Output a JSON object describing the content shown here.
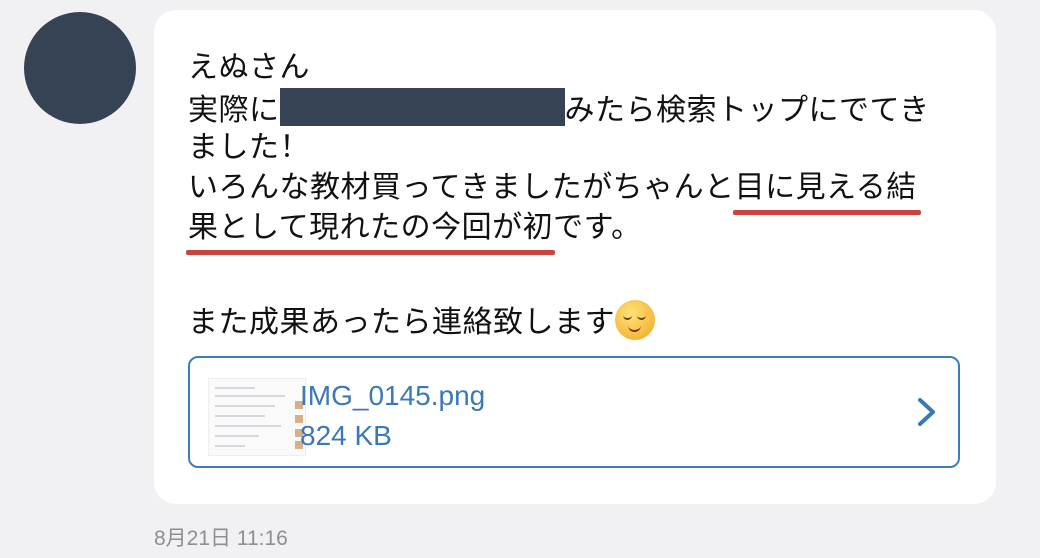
{
  "message": {
    "line1": "えぬさん",
    "line2_before": "実際に",
    "line2_after": "みたら検索トップにでてき",
    "line3": "ました！",
    "line4_before": "いろんな教材買ってきましたがちゃんと",
    "line4_highlight": "目に見える結",
    "line5_highlight": "果として現れたの今回が初",
    "line5_after": "です。",
    "line6": "また成果あったら連絡致します",
    "emoji": "relieved-face-emoji"
  },
  "attachment": {
    "file_name": "IMG_0145.png",
    "file_size": "824 KB",
    "icon": "chevron-right-icon"
  },
  "timestamp": "8月21日 11:16",
  "colors": {
    "bubble": "#ffffff",
    "background": "#f1f1f4",
    "avatar": "#364354",
    "link": "#3a78b8",
    "underline": "#c9443a"
  }
}
